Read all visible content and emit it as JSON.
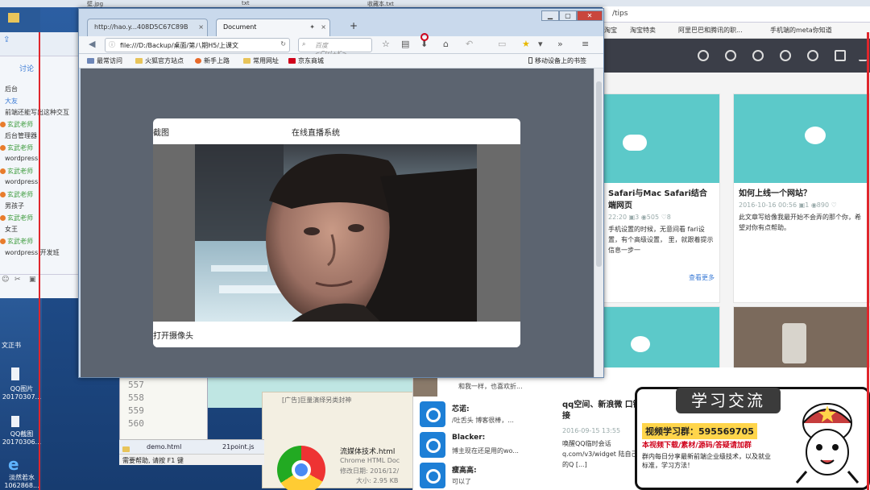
{
  "desktop": {
    "top_labels": [
      "壁.jpg",
      "txt",
      "收藏本.txt"
    ],
    "icons": [
      {
        "label": "QQ图片20170307..."
      },
      {
        "label": "QQ截图20170306..."
      },
      {
        "label": "淡然若水1062868..."
      }
    ],
    "side_fragment": "文正书"
  },
  "chat": {
    "tab": "讨论",
    "lines": [
      {
        "text": "后台",
        "type": "msg"
      },
      {
        "text": "大友",
        "type": "link"
      },
      {
        "text": "前端还能写出这种交互",
        "type": "msg"
      },
      {
        "text": "玄武老师",
        "type": "nick"
      },
      {
        "text": "后台管理器",
        "type": "msg"
      },
      {
        "text": "玄武老师",
        "type": "nick"
      },
      {
        "text": "wordpress",
        "type": "msg"
      },
      {
        "text": "玄武老师",
        "type": "nick"
      },
      {
        "text": "wordpress",
        "type": "msg"
      },
      {
        "text": "玄武老师",
        "type": "nick"
      },
      {
        "text": "男孩子",
        "type": "msg"
      },
      {
        "text": "玄武老师",
        "type": "nick"
      },
      {
        "text": "女王",
        "type": "msg"
      },
      {
        "text": "玄武老师",
        "type": "nick"
      },
      {
        "text": "wordpress 开发班",
        "type": "msg"
      }
    ]
  },
  "browser": {
    "tabs": [
      {
        "label": "http://hao.y...408D5C67C89B",
        "active": false
      },
      {
        "label": "Document",
        "active": true
      }
    ],
    "url": "file:///D:/Backup/桌面/第八期H5/上课文",
    "search_placeholder": "百度 <Ctrl+K>",
    "bookmarks": [
      "最常访问",
      "火狐官方站点",
      "新手上路",
      "常用网址",
      "京东商城"
    ],
    "mobile_bookmarks": "移动设备上的书签",
    "page": {
      "modal_left_title": "截图",
      "modal_center_title": "在线直播系统",
      "footer_button": "打开摄像头"
    }
  },
  "background_web": {
    "url_fragment": "/tips",
    "bookmarks": [
      "淘宝",
      "淘宝特卖",
      "阿里巴巴和腾讯的职...",
      "手机端的meta你知道"
    ],
    "cards": [
      {
        "title": "Safari与Mac Safari结合 端网页",
        "meta": "22:20 ▣3 ◉505 ♡8",
        "desc": "手机设置的时候，无意间看 fari设置，有个高级设置， 里，就跟着提示信息一步一",
        "more": "查看更多"
      },
      {
        "title": "如何上线一个网站？",
        "meta": "2016-10-16 00:56 ▣1 ◉890 ♡",
        "desc": "此文章写给像我最开始不会弄的那个你，希望对你有点帮助。"
      }
    ],
    "lower_card_title": "qq空间、新浪微 口链接",
    "lower_card_meta": "2016-09-15 13:55",
    "lower_card_desc": "唤醒QQ临时会话 q.com/v3/widget 陆自己的Q [...]"
  },
  "feed": {
    "top_text": "和我一样，也喜欢折...",
    "items": [
      {
        "name": "芯诺:",
        "text": "/吐舌头 博客很棒，..."
      },
      {
        "name": "Blacker:",
        "text": "博主现在还是用的wo..."
      },
      {
        "name": "瘦高高:",
        "text": "可以了"
      }
    ]
  },
  "editor": {
    "lines": [
      "557",
      "558",
      "559",
      "560"
    ]
  },
  "ad_text": "[广告]巨量演绎另类封神",
  "taskstrip": [
    "demo.html",
    "21point.js"
  ],
  "statusbar": "需要帮助, 请按 F1 键",
  "file_info": {
    "name": "流媒体技术.html",
    "type": "Chrome HTML Doc",
    "date": "修改日期: 2016/12/",
    "size": "大小: 2.95 KB"
  },
  "promo": {
    "heading": "学习交流",
    "group": "视频学习群：595569705",
    "line2": "本视频下载/素材/源码/答疑请加群",
    "line3": "群内每日分享最新前端企业级技术，以及就业标准，学习方法！"
  },
  "colors": {
    "accent": "#3b7bd6",
    "promo_highlight": "#ffd54a",
    "red": "#d0021b",
    "teal": "#5cc9c9"
  }
}
